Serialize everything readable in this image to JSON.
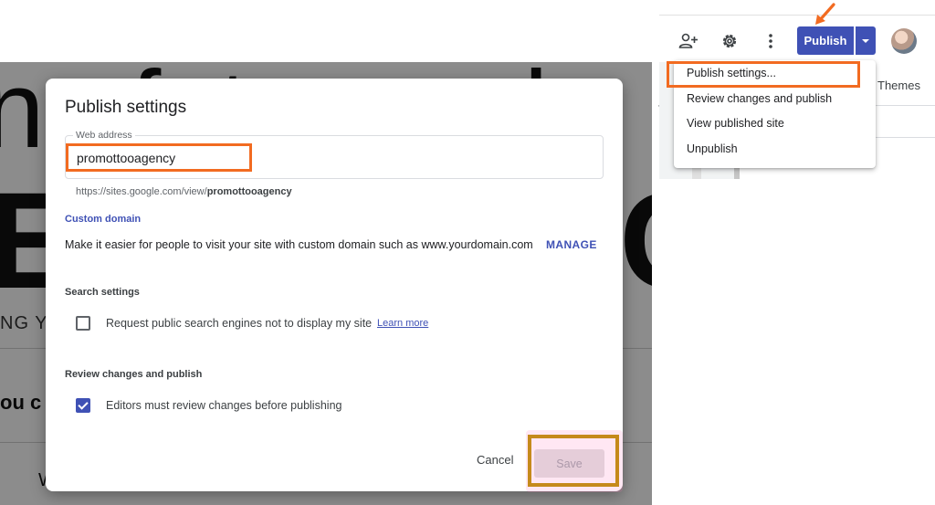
{
  "toolbar": {
    "publish_label": "Publish",
    "icons": [
      "add-person-icon",
      "gear-icon",
      "more-vert-icon",
      "dropdown-caret-icon"
    ]
  },
  "publish_menu": {
    "items": [
      {
        "label": "Publish settings..."
      },
      {
        "label": "Review changes and publish"
      },
      {
        "label": "View published site"
      },
      {
        "label": "Unpublish"
      }
    ]
  },
  "right_panel": {
    "themes_tab": "Themes"
  },
  "modal": {
    "title": "Publish settings",
    "web_address_label": "Web address",
    "web_address_value": "promottooagency",
    "url_prefix": "https://sites.google.com/view/",
    "url_slug": "promottooagency",
    "custom_domain_title": "Custom domain",
    "custom_domain_desc": "Make it easier for people to visit your site with custom domain such as www.yourdomain.com",
    "manage_label": "MANAGE",
    "search_settings_title": "Search settings",
    "search_checkbox_label": "Request public search engines not to display my site",
    "search_checked": false,
    "learn_more": "Learn more",
    "review_title": "Review changes and publish",
    "review_checkbox_label": "Editors must review changes before publishing",
    "review_checked": true,
    "cancel_label": "Cancel",
    "save_label": "Save"
  },
  "colors": {
    "accent": "#3f51b5",
    "annotation_orange": "#f26b21",
    "annotation_gold": "#c58a1b"
  }
}
